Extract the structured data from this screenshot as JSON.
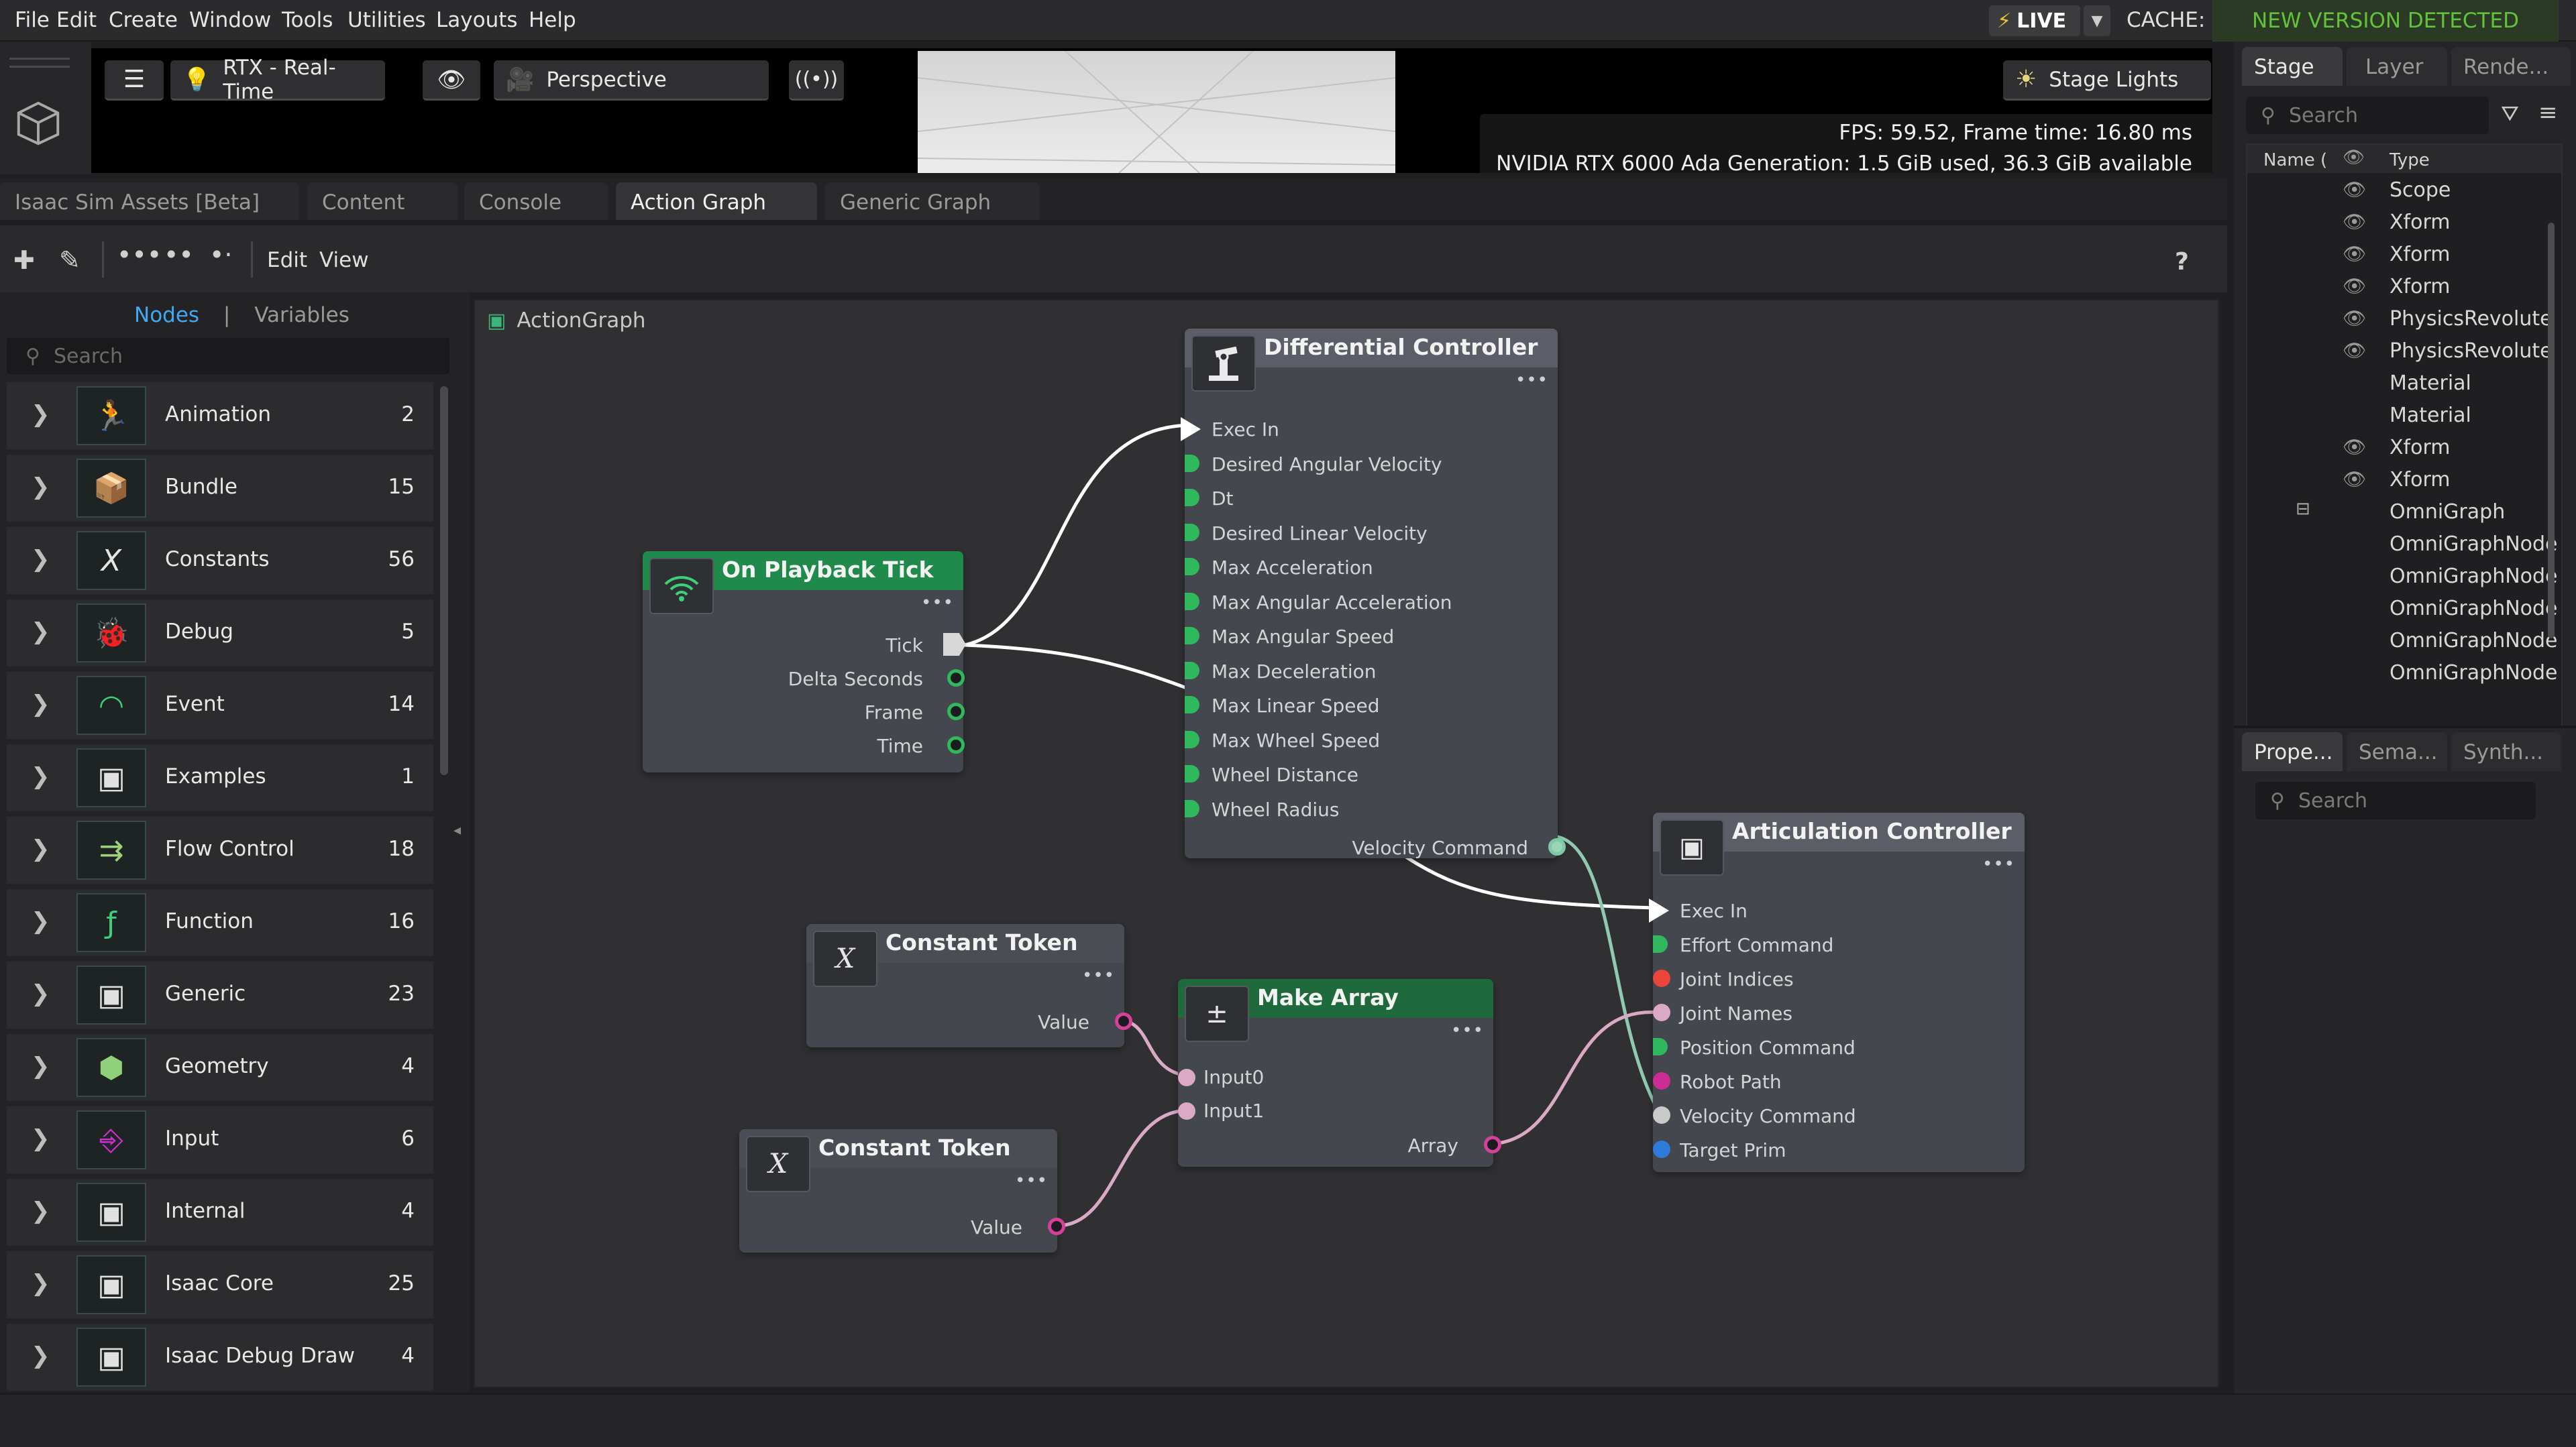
{
  "menu": [
    "File",
    "Edit",
    "Create",
    "Window",
    "Tools",
    "Utilities",
    "Layouts",
    "Help"
  ],
  "status": {
    "live": "LIVE",
    "cache": "CACHE:",
    "new_version": "NEW VERSION DETECTED"
  },
  "viewport": {
    "render_mode": "RTX - Real-Time",
    "camera": "Perspective",
    "lights": "Stage Lights",
    "fps": "FPS: 59.52, Frame time: 16.80 ms",
    "gpu": "NVIDIA RTX 6000 Ada Generation: 1.5 GiB used, 36.3 GiB available"
  },
  "bottom_tabs": [
    "Isaac Sim Assets [Beta]",
    "Content",
    "Console",
    "Action Graph",
    "Generic Graph"
  ],
  "active_tab": "Action Graph",
  "graph_toolbar": {
    "edit": "Edit",
    "view": "View",
    "help": "?"
  },
  "library": {
    "tab_nodes": "Nodes",
    "tab_sep": "|",
    "tab_variables": "Variables",
    "search_placeholder": "Search",
    "categories": [
      {
        "label": "Animation",
        "count": "2",
        "icon": "running-figure-icon"
      },
      {
        "label": "Bundle",
        "count": "15",
        "icon": "box-icon"
      },
      {
        "label": "Constants",
        "count": "56",
        "icon": "x-variable-icon"
      },
      {
        "label": "Debug",
        "count": "5",
        "icon": "bug-icon"
      },
      {
        "label": "Event",
        "count": "14",
        "icon": "wireless-icon"
      },
      {
        "label": "Examples",
        "count": "1",
        "icon": "window-icon"
      },
      {
        "label": "Flow Control",
        "count": "18",
        "icon": "flow-icon"
      },
      {
        "label": "Function",
        "count": "16",
        "icon": "function-icon"
      },
      {
        "label": "Generic",
        "count": "23",
        "icon": "window-icon"
      },
      {
        "label": "Geometry",
        "count": "4",
        "icon": "cube-icon"
      },
      {
        "label": "Input",
        "count": "6",
        "icon": "input-icon"
      },
      {
        "label": "Internal",
        "count": "4",
        "icon": "window-icon"
      },
      {
        "label": "Isaac Core",
        "count": "25",
        "icon": "window-icon"
      },
      {
        "label": "Isaac Debug Draw",
        "count": "4",
        "icon": "window-icon"
      }
    ]
  },
  "graph": {
    "breadcrumb": "ActionGraph",
    "nodes": {
      "tick": {
        "title": "On Playback Tick",
        "outputs": [
          "Tick",
          "Delta Seconds",
          "Frame",
          "Time"
        ]
      },
      "diff": {
        "title": "Differential Controller",
        "inputs": [
          "Exec In",
          "Desired Angular Velocity",
          "Dt",
          "Desired Linear Velocity",
          "Max Acceleration",
          "Max Angular Acceleration",
          "Max Angular Speed",
          "Max Deceleration",
          "Max Linear Speed",
          "Max Wheel Speed",
          "Wheel Distance",
          "Wheel Radius"
        ],
        "output": "Velocity Command"
      },
      "const1": {
        "title": "Constant Token",
        "output": "Value"
      },
      "const2": {
        "title": "Constant Token",
        "output": "Value"
      },
      "make_array": {
        "title": "Make Array",
        "inputs": [
          "Input0",
          "Input1"
        ],
        "output": "Array"
      },
      "artic": {
        "title": "Articulation Controller",
        "inputs": [
          "Exec In",
          "Effort Command",
          "Joint Indices",
          "Joint Names",
          "Position Command",
          "Robot Path",
          "Velocity Command",
          "Target Prim"
        ]
      }
    }
  },
  "right_panel": {
    "tabs": [
      "Stage",
      "Layer",
      "Rende..."
    ],
    "search_placeholder": "Search",
    "columns": {
      "name": "Name (",
      "type": "Type"
    },
    "rows": [
      "Scope",
      "Xform",
      "Xform",
      "Xform",
      "PhysicsRevolute",
      "PhysicsRevolute",
      "Material",
      "Material",
      "Xform",
      "Xform",
      "OmniGraph",
      "OmniGraphNode",
      "OmniGraphNode",
      "OmniGraphNode",
      "OmniGraphNode",
      "OmniGraphNode"
    ],
    "prop_tabs": [
      "Prope...",
      "Sema...",
      "Synth..."
    ],
    "prop_search_placeholder": "Search"
  },
  "colors": {
    "exec": "#ffffff",
    "float_port": "#2fb85c",
    "token_port": "#d6409a",
    "header_green": "#1f8a4c"
  }
}
